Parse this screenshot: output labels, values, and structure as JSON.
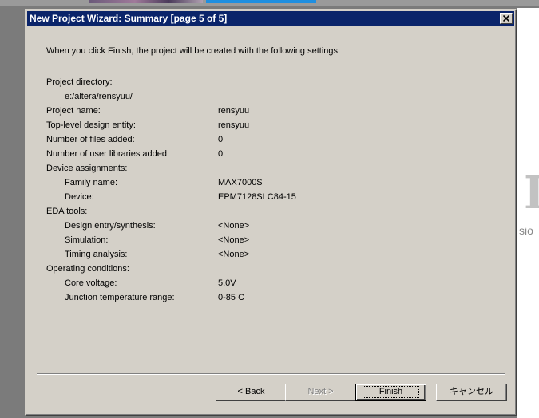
{
  "window": {
    "title": "New Project Wizard: Summary [page 5 of 5]",
    "close_glyph": "×"
  },
  "summary": {
    "intro": "When you click Finish, the project will be created with the following settings:",
    "project_directory_label": "Project directory:",
    "project_directory_value": "e:/altera/rensyuu/",
    "project_name_label": "Project name:",
    "project_name_value": "rensyuu",
    "top_level_label": "Top-level design entity:",
    "top_level_value": "rensyuu",
    "files_added_label": "Number of files added:",
    "files_added_value": "0",
    "user_libraries_label": "Number of user libraries added:",
    "user_libraries_value": "0",
    "device_assignments_label": "Device assignments:",
    "family_name_label": "Family name:",
    "family_name_value": "MAX7000S",
    "device_label": "Device:",
    "device_value": "EPM7128SLC84-15",
    "eda_tools_label": "EDA tools:",
    "design_entry_label": "Design entry/synthesis:",
    "design_entry_value": "<None>",
    "simulation_label": "Simulation:",
    "simulation_value": "<None>",
    "timing_analysis_label": "Timing analysis:",
    "timing_analysis_value": "<None>",
    "operating_conditions_label": "Operating conditions:",
    "core_voltage_label": "Core voltage:",
    "core_voltage_value": "5.0V",
    "junction_temp_label": "Junction temperature range:",
    "junction_temp_value": "0-85  C"
  },
  "buttons": {
    "back": "< Back",
    "next": "Next >",
    "next_enabled": false,
    "finish": "Finish",
    "cancel": "キャンセル"
  },
  "background": {
    "big_letter": "I",
    "partial_text": "sio"
  },
  "colors": {
    "title_bar": "#0a246a",
    "dialog_face": "#d4d0c8",
    "desktop": "#7b7b7b"
  }
}
